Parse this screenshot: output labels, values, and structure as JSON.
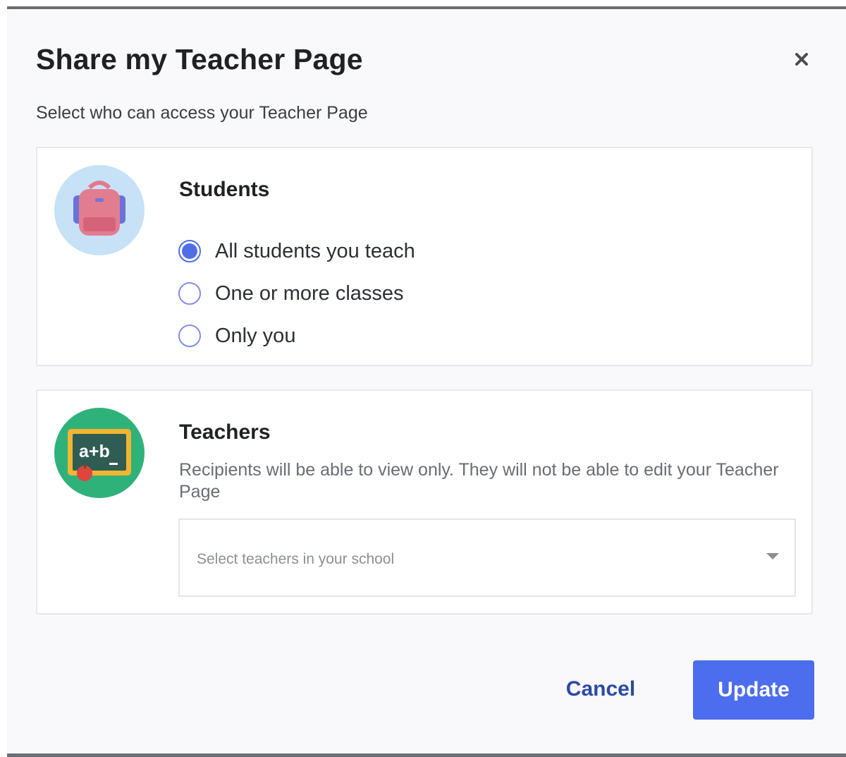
{
  "dialog": {
    "title": "Share my Teacher Page",
    "subtitle": "Select who can access your Teacher Page",
    "close_icon": "close-icon"
  },
  "students": {
    "heading": "Students",
    "icon": "backpack-icon",
    "options": [
      {
        "label": "All students you teach",
        "checked": true
      },
      {
        "label": "One or more classes",
        "checked": false
      },
      {
        "label": "Only you",
        "checked": false
      }
    ]
  },
  "teachers": {
    "heading": "Teachers",
    "icon": "chalkboard-icon",
    "description": "Recipients will be able to view only. They will not be able to edit your Teacher Page",
    "select_placeholder": "Select teachers in your school"
  },
  "actions": {
    "cancel_label": "Cancel",
    "update_label": "Update"
  },
  "colors": {
    "accent": "#4c6ded",
    "cancel_text": "#2c4aa3",
    "students_avatar_bg": "#c7e1f7",
    "teachers_avatar_bg": "#2fb27a"
  }
}
